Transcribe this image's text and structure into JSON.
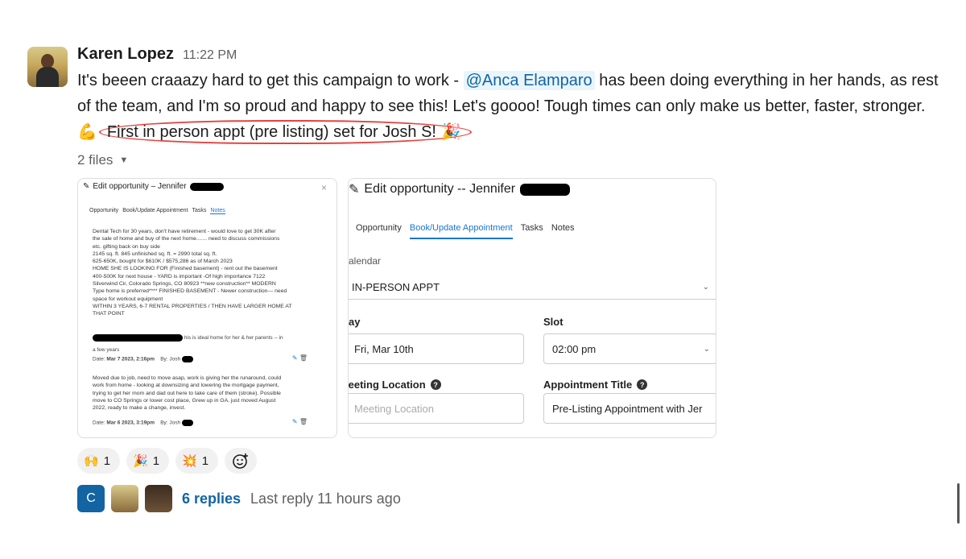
{
  "message": {
    "author": "Karen Lopez",
    "time": "11:22 PM",
    "text_part1": "It's beeen craaazy hard to get this campaign to work - ",
    "mention": "@Anca Elamparo",
    "text_part2": " has been doing everything in her hands, as rest of the team, and I'm so proud and happy to see this! Let's goooo! Tough times can only make us better, faster, stronger. ",
    "emoji_muscle": "💪",
    "circled_text": "First in person appt (pre listing) set for Josh S! ",
    "emoji_party": "🎉"
  },
  "files": {
    "label": "2 files",
    "file1": {
      "title": "Edit opportunity – Jennifer",
      "close": "×",
      "tabs": [
        "Opportunity",
        "Book/Update Appointment",
        "Tasks",
        "Notes"
      ],
      "note1": "Dental Tech for 30 years, don't have retirement - would love to get 30K after\nthe sale of home and buy of the next home....... need to discuss commissions\netc. gifting back on buy side\n2145 sq. ft. 845 unfinished sq. ft. = 2990 total sq. ft.\n625-650K, bought for $610K / $575,286 as of March 2023\nHOME SHE IS LOOKING FOR (Finished basement) - rent out the basement\n400-500K for next house - YARD is important -Of high importance 7122\nSilverwind Cir, Colorado Springs, CO 80923 **new construction** MODERN\nType home is preferred**** FINISHED BASEMENT - Newer construction--- need\nspace for workout equipment\nWITHIN 3 YEARS, 6-7 RENTAL PROPERTIES / THEN HAVE LARGER HOME AT\nTHAT POINT",
      "note1_tail": "his is ideal home for her & her parents -- in",
      "note1_tail2": "a few years",
      "note1_date_label": "Date:",
      "note1_date": "Mar 7 2023, 2:16pm",
      "note1_by": "By: Josh",
      "note2": "Moved due to job, need to move asap, work is giving her the runaround, could\nwork from home - looking at downsizing and lowering the mortgage payment,\ntrying to get her mom and dad out here to take care of them (stroke). Possible\nmove to CO Springs or lower cost place, Grew up in GA, just moved August\n2022, ready to make a change, invest.",
      "note2_date_label": "Date:",
      "note2_date": "Mar 6 2023, 3:19pm",
      "note2_by": "By: Josh"
    },
    "file2": {
      "title": "Edit opportunity -- Jennifer",
      "tabs": [
        "Opportunity",
        "Book/Update Appointment",
        "Tasks",
        "Notes"
      ],
      "calendar_label": "alendar",
      "calendar_value": "IN-PERSON APPT",
      "day_label": "ay",
      "day_value": "Fri, Mar 10th",
      "slot_label": "Slot",
      "slot_value": "02:00 pm",
      "location_label": "leeting Location",
      "location_placeholder": "Meeting Location",
      "appt_title_label": "Appointment Title",
      "appt_title_value": "Pre-Listing Appointment with Jer",
      "help_glyph": "?"
    }
  },
  "reactions": [
    {
      "emoji": "🙌",
      "count": "1"
    },
    {
      "emoji": "🎉",
      "count": "1"
    },
    {
      "emoji": "💥",
      "count": "1"
    }
  ],
  "thread": {
    "avatar_letter": "C",
    "replies": "6 replies",
    "last_reply": "Last reply 11 hours ago"
  },
  "colors": {
    "link": "#1264a3",
    "circle": "#e2443f",
    "tab_active": "#1976d2"
  }
}
